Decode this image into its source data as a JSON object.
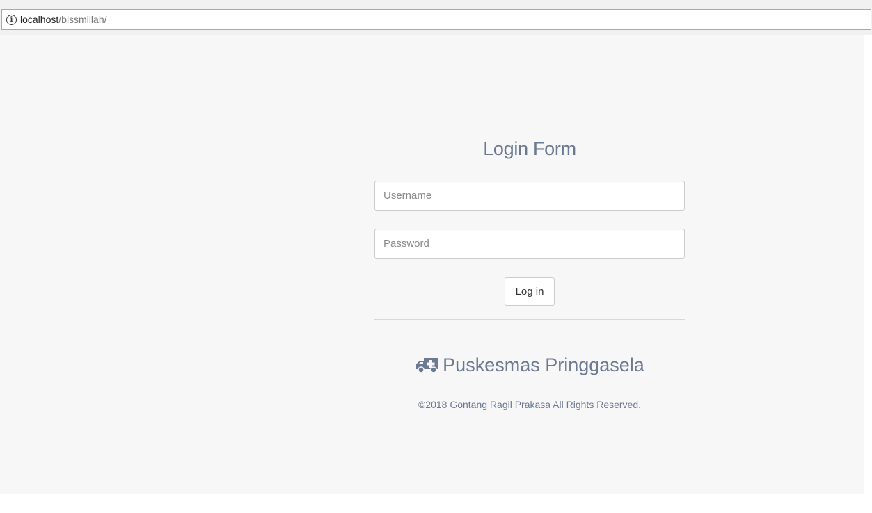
{
  "browser": {
    "url_host": "localhost",
    "url_path": "/bissmillah/"
  },
  "login": {
    "title": "Login Form",
    "username_placeholder": "Username",
    "password_placeholder": "Password",
    "button_label": "Log in"
  },
  "footer": {
    "brand_name": "Puskesmas Pringgasela",
    "brand_icon": "ambulance-icon",
    "copyright": "©2018 Gontang Ragil Prakasa All Rights Reserved."
  },
  "colors": {
    "accent_text": "#6b7991",
    "page_background": "#f7f7f7"
  }
}
